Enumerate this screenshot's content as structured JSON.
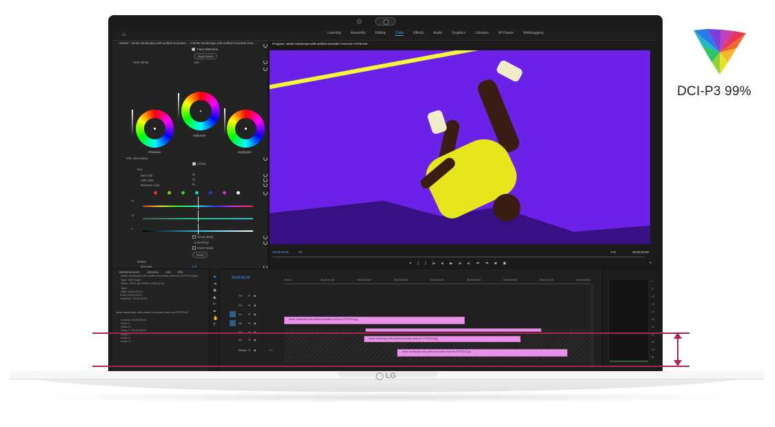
{
  "window": {
    "workspace_tabs": [
      "Learning",
      "Assembly",
      "Editing",
      "Color",
      "Effects",
      "Audio",
      "Graphics",
      "Libraries",
      "All Panels",
      "Webloagging"
    ],
    "active_tab": "Color"
  },
  "lumetri": {
    "title": "Master * winter-landscape-with-wolfed-mountain-...  ▾ winter-landscape-with-wolfed-mountain-rese...",
    "face_detection": "Face Detection",
    "match_btn": "Apply Match",
    "hdr_white": "HDR White",
    "hdr_value": "100",
    "wheel_labels": {
      "shadows": "Shadows",
      "midtones": "Midtones",
      "highlights": "Highlights"
    },
    "hsl_secondary": "HSL Secondary",
    "active_label": "Active",
    "key": "Key",
    "set_color": "Set color",
    "add_color": "Add color",
    "remove_color": "Remove color",
    "h": "H",
    "s": "S",
    "l": "L",
    "show_mask": "Show Mask",
    "color_gray": "Color/Gray",
    "invert_mask": "Invert Mask",
    "reset_btn": "Reset",
    "refine": "Refine",
    "denoise": "Denoise",
    "denoise_val": "0.0",
    "blur": "Blur",
    "blur_val": "0.0",
    "swatch_colors": [
      "#d33",
      "#7c2",
      "#3c3",
      "#2cc",
      "#33d",
      "#c3c",
      "#eee"
    ]
  },
  "program": {
    "title": "Program: winter-landscape-with-wolfed-mountain-reservoir-FZTEH4Z",
    "timecode_left": "00;00;00;00",
    "fit": "Fit",
    "full": "Full",
    "timecode_right": "00;00;03;00",
    "transport": [
      "▾",
      "{",
      "}",
      "|◂",
      "◂|",
      "▶",
      "|▸",
      "▸|",
      "⇄",
      "⇆",
      "◙",
      "▣"
    ]
  },
  "project": {
    "tabs": [
      "Media Browser",
      "Libraries",
      "Info",
      "Effe"
    ],
    "lines": [
      "winter-landscape-with-wolfed-mountain-reservoir-FZTEH4Z.jpg",
      "Type: Still Image",
      "Video: 29.97 fps, 6000 x 4000 (1.0)",
      "Tape:",
      "Start: 00:00:00:00",
      "End: 00:00:04:29",
      "Duration: 00:00:05:00",
      "winter-landscape-with-wolfed-mountain-reservoir-FZTEH4Z",
      "Current: 00:00:00:00",
      "Video 3:",
      "Video 2:",
      "Video 1: 00:00:00:00",
      "Audio 1:",
      "Audio 2:",
      "Audio 3:"
    ]
  },
  "timeline": {
    "timecode": "00;00;00;00",
    "ruler": [
      ":00:00",
      "00;00;01;00",
      "00;00;02;00",
      "00;00;03;00",
      "00;00;04;00",
      "00;00;05;00",
      "00;00;06;00",
      "00;00;07;00",
      "00;00;08;00"
    ],
    "tracks": [
      "V3",
      "V2",
      "V1",
      "A1",
      "A2",
      "A3",
      "Master"
    ],
    "master_val": "0.0",
    "clip_label": "winter-landscape-with-wolfed-mountain-reservoir-FZTEH4Z.jpg"
  },
  "meters": {
    "scale": [
      "0",
      "-6",
      "-12",
      "-18",
      "-24",
      "-30",
      "-36",
      "-42",
      "-48",
      "-54",
      "dB"
    ]
  },
  "badge": {
    "label": "DCI-P3 99%"
  },
  "logo": "LG"
}
